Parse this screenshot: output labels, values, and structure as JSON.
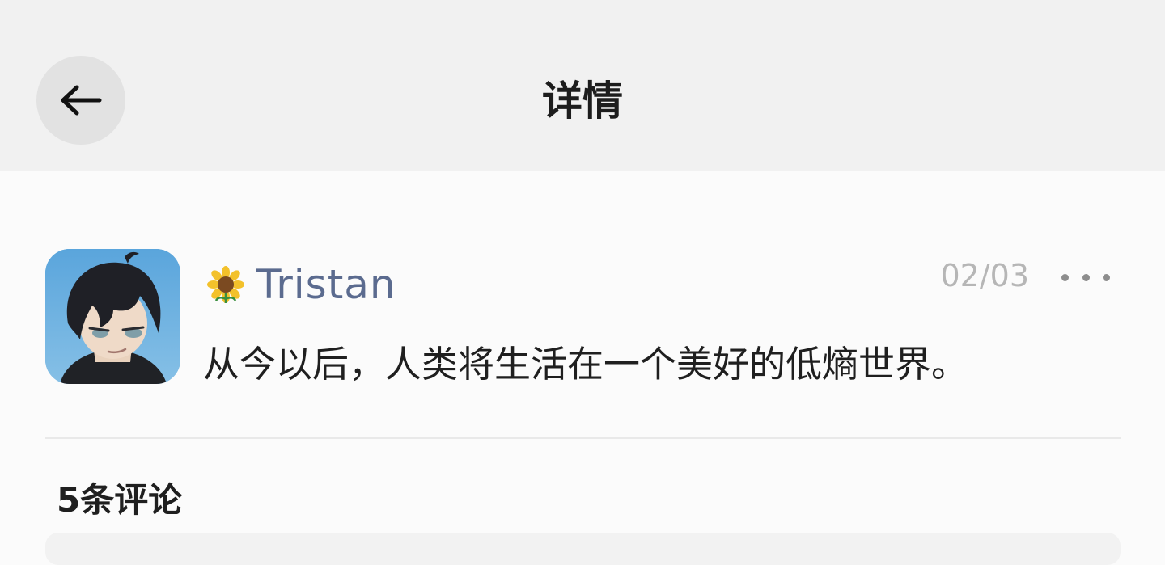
{
  "header": {
    "title": "详情",
    "back_icon": "arrow-left-icon"
  },
  "post": {
    "author": {
      "badge_icon": "sunflower-icon",
      "name": "Tristan"
    },
    "date": "02/03",
    "text": "从今以后，人类将生活在一个美好的低熵世界。",
    "more_icon": "more-horizontal-icon"
  },
  "comments": {
    "count_label": "5条评论"
  },
  "colors": {
    "header_bg": "#f1f1f1",
    "name": "#5b6b8f",
    "date": "#b6b6b6",
    "text": "#1f1f1f"
  }
}
